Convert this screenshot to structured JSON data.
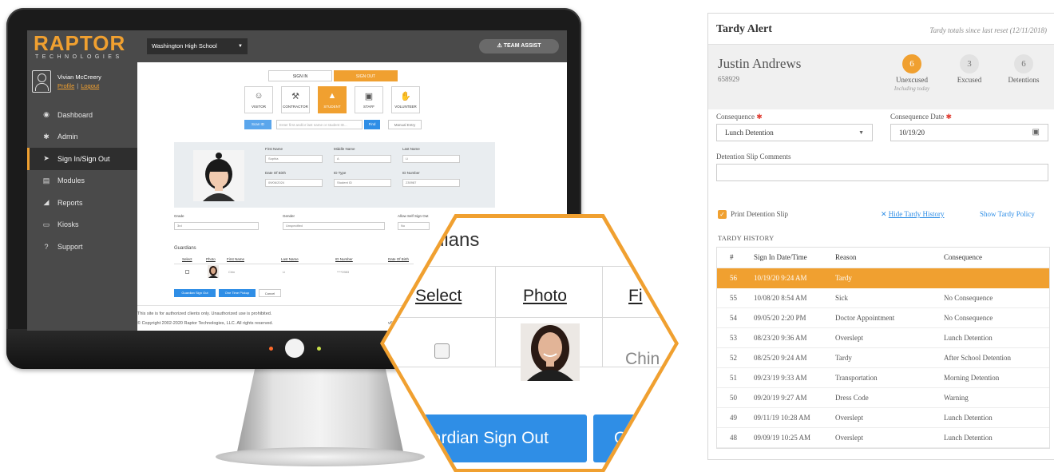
{
  "raptor": {
    "logo_main": "RAPTOR",
    "logo_sub": "TECHNOLOGIES",
    "school": "Washington High School",
    "team_assist": "TEAM ASSIST",
    "user": {
      "name": "Vivian McCreery",
      "profile": "Profile",
      "logout": "Logout"
    },
    "nav": [
      {
        "icon": "dashboard-icon",
        "label": "Dashboard"
      },
      {
        "icon": "admin-icon",
        "label": "Admin"
      },
      {
        "icon": "sign-in-icon",
        "label": "Sign In/Sign Out"
      },
      {
        "icon": "modules-icon",
        "label": "Modules"
      },
      {
        "icon": "reports-icon",
        "label": "Reports"
      },
      {
        "icon": "kiosks-icon",
        "label": "Kiosks"
      },
      {
        "icon": "support-icon",
        "label": "Support"
      }
    ],
    "sign_in": "SIGN IN",
    "sign_out": "SIGN OUT",
    "types": [
      "VISITOR",
      "CONTRACTOR",
      "STUDENT",
      "STAFF",
      "VOLUNTEER"
    ],
    "scan_id": "Scan ID",
    "search_placeholder": "Enter first and/or last name or student ID...",
    "find": "Find",
    "manual_entry": "Manual Entry",
    "student": {
      "first_name_label": "First Name",
      "first_name": "Sophia",
      "middle_name_label": "Middle Name",
      "middle_name": "A",
      "last_name_label": "Last Name",
      "last_name": "Li",
      "dob_label": "Date Of Birth",
      "dob": "09/06/2024",
      "id_type_label": "ID Type",
      "id_type": "Student ID",
      "id_number_label": "ID Number",
      "id_number": "230987"
    },
    "grade_label": "Grade",
    "grade": "3rd",
    "gender_label": "Gender",
    "gender": "Unspecified",
    "self_sign_out_label": "Allow Self Sign Out",
    "self_sign_out": "No",
    "guardians_label": "Guardians",
    "guardian_cols": [
      "Select",
      "Photo",
      "First Name",
      "Last Name",
      "ID Number",
      "Date Of Birth"
    ],
    "guardian_row": {
      "first": "Chin",
      "last": "Li",
      "id": "****0983"
    },
    "guardian_sign_out": "Guardian Sign Out",
    "one_time_pickup": "One Time Pickup",
    "cancel": "Cancel",
    "footer_1": "This site is for authorized clients only. Unauthorized use is prohibited.",
    "footer_2": "© Copyright 2002-2020 Raptor Technologies, LLC. All rights reserved.",
    "version": "v6.1"
  },
  "zoom": {
    "title": "dians",
    "cols": [
      "Select",
      "Photo",
      "Fi"
    ],
    "cell_text": "Chin",
    "button_1": "ardian Sign Out",
    "button_2": "O"
  },
  "tardy": {
    "title": "Tardy Alert",
    "subtitle": "Tardy totals since last reset (12/11/2018)",
    "student_name": "Justin Andrews",
    "student_id": "658929",
    "stats": [
      {
        "value": "6",
        "label": "Unexcused",
        "note": "Including today",
        "color": "#f0a030"
      },
      {
        "value": "3",
        "label": "Excused",
        "note": "",
        "color": "#e2e2e2"
      },
      {
        "value": "6",
        "label": "Detentions",
        "note": "",
        "color": "#e2e2e2"
      }
    ],
    "consequence_label": "Consequence",
    "consequence": "Lunch Detention",
    "date_label": "Consequence Date",
    "date": "10/19/20",
    "comments_label": "Detention Slip Comments",
    "comments": "",
    "print_label": "Print Detention Slip",
    "hide_history": "Hide Tardy History",
    "show_policy": "Show Tardy Policy",
    "history_label": "TARDY HISTORY",
    "history_cols": [
      "#",
      "Sign In Date/Time",
      "Reason",
      "Consequence"
    ],
    "history": [
      {
        "num": "56",
        "time": "10/19/20 9:24 AM",
        "reason": "Tardy",
        "consequence": ""
      },
      {
        "num": "55",
        "time": "10/08/20 8:54 AM",
        "reason": "Sick",
        "consequence": "No Consequence"
      },
      {
        "num": "54",
        "time": "09/05/20 2:20 PM",
        "reason": "Doctor Appointment",
        "consequence": "No Consequence"
      },
      {
        "num": "53",
        "time": "08/23/20 9:36 AM",
        "reason": "Overslept",
        "consequence": "Lunch Detention"
      },
      {
        "num": "52",
        "time": "08/25/20 9:24 AM",
        "reason": "Tardy",
        "consequence": "After School Detention"
      },
      {
        "num": "51",
        "time": "09/23/19 9:33 AM",
        "reason": "Transportation",
        "consequence": "Morning Detention"
      },
      {
        "num": "50",
        "time": "09/20/19 9:27 AM",
        "reason": "Dress Code",
        "consequence": "Warning"
      },
      {
        "num": "49",
        "time": "09/11/19 10:28 AM",
        "reason": "Overslept",
        "consequence": "Lunch Detention"
      },
      {
        "num": "48",
        "time": "09/09/19 10:25 AM",
        "reason": "Overslept",
        "consequence": "Lunch Detention"
      }
    ],
    "selected_index": 0
  }
}
